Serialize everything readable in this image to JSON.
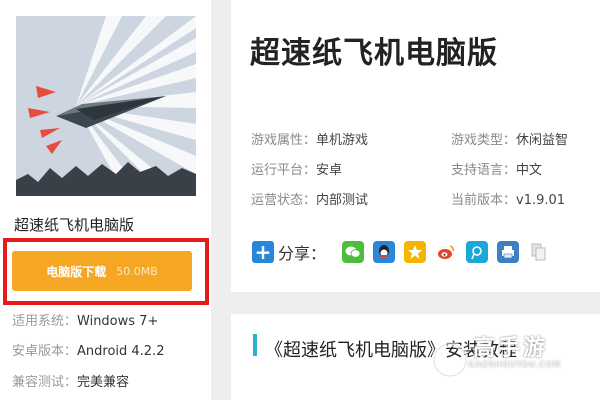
{
  "app": {
    "name": "超速纸飞机电脑版",
    "download_label": "电脑版下载",
    "download_size": "50.0MB"
  },
  "specs": [
    {
      "key": "适用系统：",
      "value": "Windows 7+"
    },
    {
      "key": "安卓版本：",
      "value": "Android 4.2.2"
    },
    {
      "key": "兼容测试：",
      "value": "完美兼容"
    }
  ],
  "game": {
    "title": "超速纸飞机电脑版",
    "attributes": [
      {
        "key": "游戏属性：",
        "value": "单机游戏"
      },
      {
        "key": "游戏类型：",
        "value": "休闲益智"
      },
      {
        "key": "运行平台：",
        "value": "安卓"
      },
      {
        "key": "支持语言：",
        "value": "中文"
      },
      {
        "key": "运营状态：",
        "value": "内部测试"
      },
      {
        "key": "当前版本：",
        "value": "v1.9.01"
      }
    ]
  },
  "share": {
    "label": "分享：",
    "icons": [
      {
        "name": "wechat-icon",
        "color": "#4cbf3a"
      },
      {
        "name": "qq-icon",
        "color": "#2a86d8"
      },
      {
        "name": "qzone-icon",
        "color": "#f5b400"
      },
      {
        "name": "weibo-icon",
        "color": "#e5432e"
      },
      {
        "name": "tencent-weibo-icon",
        "color": "#1ba8d8"
      },
      {
        "name": "print-icon",
        "color": "#3b7fc4"
      },
      {
        "name": "copy-icon",
        "color": "#c8c8c8"
      }
    ]
  },
  "tutorial": {
    "title": "《超速纸飞机电脑版》安装教程"
  },
  "watermark": {
    "text": "高手游",
    "url": "GAOSHOUYOU.COM"
  },
  "colors": {
    "download_button": "#f5a623",
    "highlight_border": "#e31b1b",
    "accent_bar": "#28b3c8"
  }
}
